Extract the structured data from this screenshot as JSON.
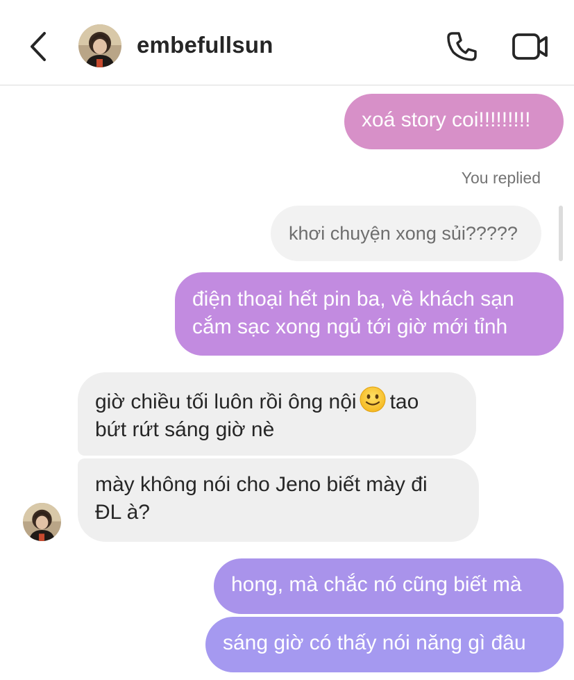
{
  "header": {
    "username": "embefullsun",
    "icons": {
      "back": "chevron-left-icon",
      "call": "phone-icon",
      "video": "video-camera-icon"
    }
  },
  "colors": {
    "bubble_pink": "#d790c8",
    "bubble_purple_1": "#c28be0",
    "bubble_purple_2": "#a993eb",
    "bubble_purple_3": "#a599f0",
    "bubble_them": "#efefef",
    "text_dark": "#262626",
    "text_muted": "#737373"
  },
  "messages": [
    {
      "from": "me",
      "lines": [
        "xoá story coi!!!!!!!!!"
      ]
    },
    {
      "from": "me",
      "reply_label": "You replied",
      "quoted": "khơi chuyện xong sủi?????"
    },
    {
      "from": "me",
      "lines": [
        "điện thoại hết pin ba, về khách sạn",
        "cắm sạc xong ngủ tới giờ mới tỉnh"
      ]
    },
    {
      "from": "them",
      "line1_before_emoji": "giờ chiều tối luôn rồi ông nội",
      "emoji": "slightly-smiling-face-emoji",
      "line1_after_emoji": "tao",
      "line2": "bứt rứt sáng giờ nè"
    },
    {
      "from": "them",
      "lines": [
        "mày không nói cho Jeno biết mày đi",
        "ĐL à?"
      ]
    },
    {
      "from": "me",
      "lines": [
        "hong, mà chắc nó cũng biết mà"
      ]
    },
    {
      "from": "me",
      "lines": [
        "sáng giờ có thấy nói năng gì đâu"
      ]
    }
  ]
}
